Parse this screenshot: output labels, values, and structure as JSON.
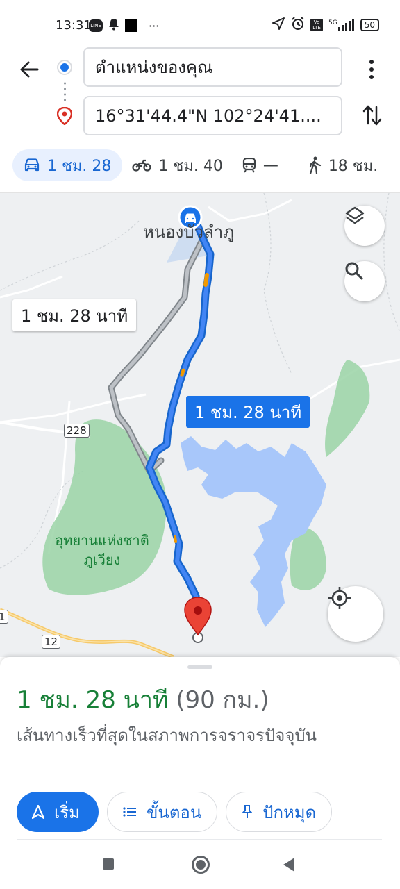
{
  "status_bar": {
    "time": "13:31",
    "more": "···",
    "network": "5G",
    "volte": "Vo LTE",
    "battery": "50"
  },
  "directions": {
    "origin": "ตำแหน่งของคุณ",
    "destination": "16°31'44.4\"N 102°24'41....",
    "modes": [
      {
        "icon": "car-icon",
        "label": "1 ชม. 28"
      },
      {
        "icon": "motorcycle-icon",
        "label": "1 ชม. 40"
      },
      {
        "icon": "transit-icon",
        "label": "—"
      },
      {
        "icon": "walk-icon",
        "label": "18 ชม."
      }
    ]
  },
  "map": {
    "place_label": "หนองบัวลำภู",
    "park_label_line1": "อุทยานแห่งชาติ",
    "park_label_line2": "ภูเวียง",
    "road_228": "228",
    "road_12": "12",
    "road_edge": "1",
    "alt_route_time": "1 ชม. 28 นาที",
    "main_route_time": "1 ชม. 28 นาที"
  },
  "sheet": {
    "duration": "1 ชม. 28 นาที",
    "distance": "(90 กม.)",
    "description": "เส้นทางเร็วที่สุดในสภาพการจราจรปัจจุบัน",
    "start_label": "เริ่ม",
    "steps_label": "ขั้นตอน",
    "pin_label": "ปักหมุด"
  },
  "colors": {
    "route_blue": "#1a73e8",
    "alt_route_gray": "#9aa0a6",
    "water": "#a8c7fa",
    "park": "#9ad3a6",
    "duration_green": "#188038"
  }
}
